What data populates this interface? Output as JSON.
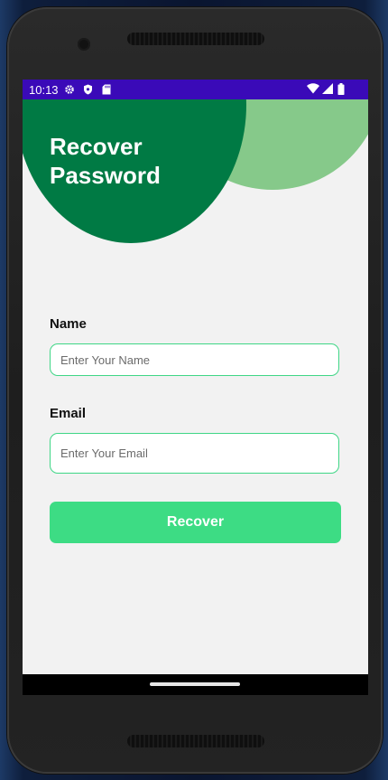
{
  "status_bar": {
    "time": "10:13",
    "left_icons": [
      "gear-icon",
      "shield-icon",
      "sd-card-icon"
    ],
    "right_icons": [
      "wifi-icon",
      "cellular-signal-icon",
      "battery-icon"
    ],
    "color": "#3a0ab8"
  },
  "header": {
    "title_line1": "Recover",
    "title_line2": "Password",
    "primary_color": "#007a44",
    "secondary_color": "#86c98a"
  },
  "form": {
    "name_label": "Name",
    "name_placeholder": "Enter Your Name",
    "name_value": "",
    "email_label": "Email",
    "email_placeholder": "Enter Your Email",
    "email_value": "",
    "submit_label": "Recover",
    "accent_color": "#3ddc84"
  }
}
